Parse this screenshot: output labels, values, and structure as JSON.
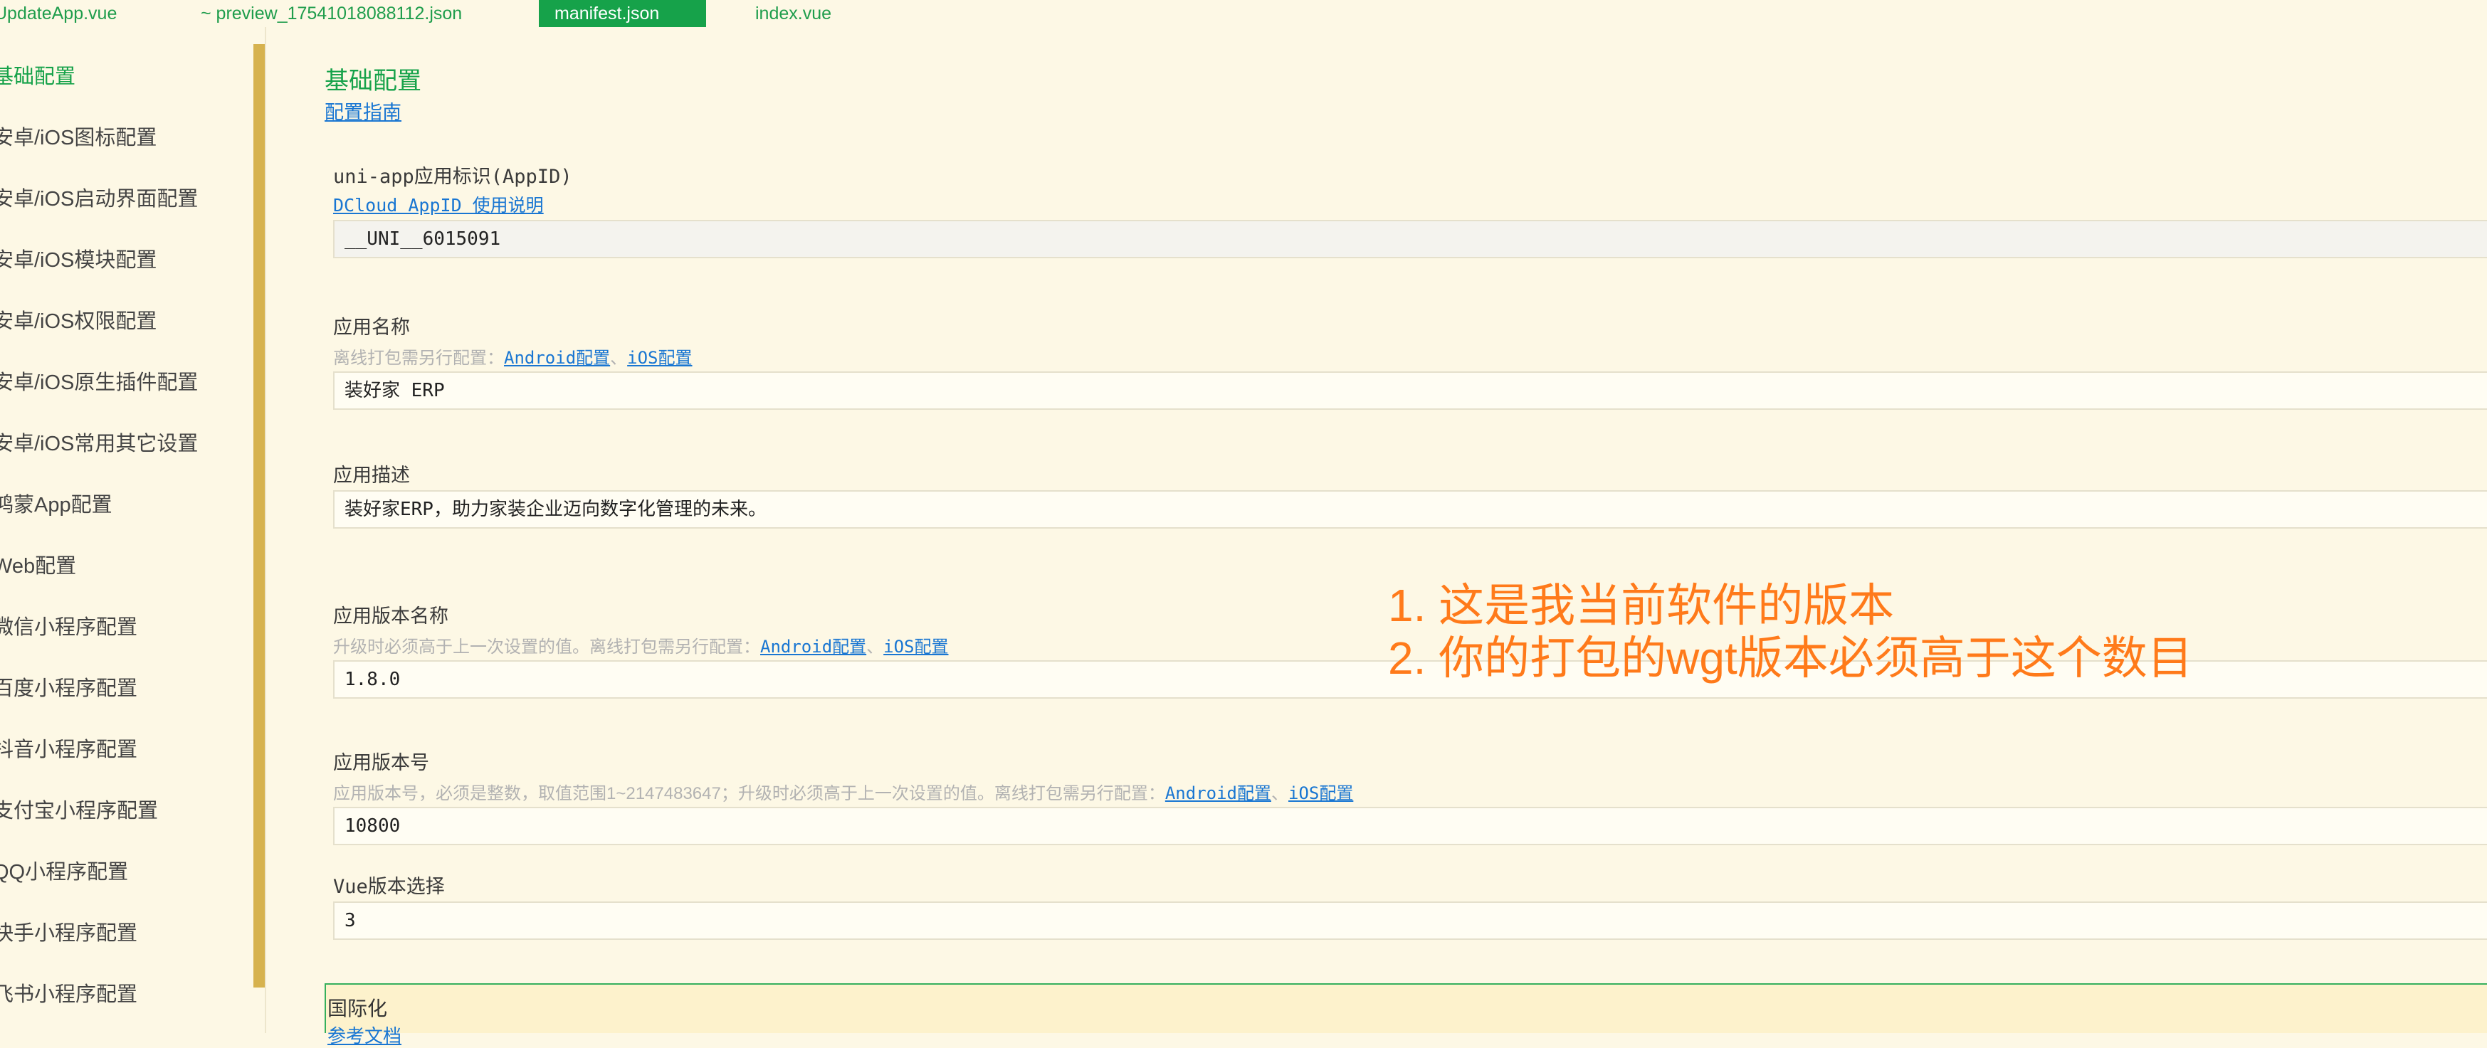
{
  "tabs": [
    {
      "label": "UpdateApp.vue",
      "active": false
    },
    {
      "label": "~ preview_17541018088112.json",
      "active": false
    },
    {
      "label": "manifest.json",
      "active": true
    },
    {
      "label": "index.vue",
      "active": false
    }
  ],
  "sidebar": {
    "items": [
      {
        "label": "基础配置",
        "active": true
      },
      {
        "label": "安卓/iOS图标配置"
      },
      {
        "label": "安卓/iOS启动界面配置"
      },
      {
        "label": "安卓/iOS模块配置"
      },
      {
        "label": "安卓/iOS权限配置"
      },
      {
        "label": "安卓/iOS原生插件配置"
      },
      {
        "label": "安卓/iOS常用其它设置"
      },
      {
        "label": "鸿蒙App配置"
      },
      {
        "label": "Web配置"
      },
      {
        "label": "微信小程序配置"
      },
      {
        "label": "百度小程序配置"
      },
      {
        "label": "抖音小程序配置"
      },
      {
        "label": "支付宝小程序配置"
      },
      {
        "label": "QQ小程序配置"
      },
      {
        "label": "快手小程序配置"
      },
      {
        "label": "飞书小程序配置"
      }
    ]
  },
  "main": {
    "title": "基础配置",
    "guide_link": "配置指南",
    "appid": {
      "label": "uni-app应用标识(AppID)",
      "link": "DCloud AppID 使用说明",
      "value": "__UNI__6015091"
    },
    "app_name": {
      "label": "应用名称",
      "desc": "离线打包需另行配置：",
      "android_link": "Android配置",
      "sep": "、",
      "ios_link": "iOS配置",
      "value": "装好家 ERP"
    },
    "app_desc": {
      "label": "应用描述",
      "value": "装好家ERP，助力家装企业迈向数字化管理的未来。"
    },
    "version_name": {
      "label": "应用版本名称",
      "desc": "升级时必须高于上一次设置的值。离线打包需另行配置：",
      "android_link": "Android配置",
      "sep": "、",
      "ios_link": "iOS配置",
      "value": "1.8.0"
    },
    "version_code": {
      "label": "应用版本号",
      "desc": "应用版本号，必须是整数，取值范围1~2147483647；升级时必须高于上一次设置的值。离线打包需另行配置：",
      "android_link": "Android配置",
      "sep": "、",
      "ios_link": "iOS配置",
      "value": "10800"
    },
    "vue_version": {
      "label": "Vue版本选择",
      "value": "3"
    },
    "i18n": {
      "title": "国际化",
      "link": "参考文档"
    }
  },
  "annotation": {
    "line1": "1. 这是我当前软件的版本",
    "line2": "2. 你的打包的wgt版本必须高于这个数目",
    "color": "#ff7a1a"
  },
  "colors": {
    "accent": "#16a24a",
    "link": "#1976d2",
    "background": "#fdf8e5",
    "scrollbar": "#d6b24e"
  }
}
